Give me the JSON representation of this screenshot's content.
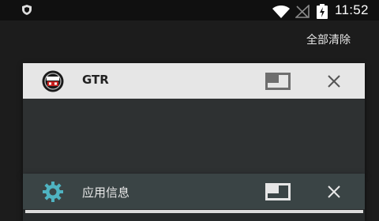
{
  "status_bar": {
    "time": "11:52",
    "icons": [
      "shield-icon",
      "wifi-icon",
      "no-signal-icon",
      "battery-charging-icon"
    ]
  },
  "recents": {
    "clear_all_label": "全部清除",
    "cards": [
      {
        "title": "GTR",
        "icon": "gtr-app-icon",
        "multiwindow_icon": "split-screen-icon",
        "close_icon": "close-icon"
      },
      {
        "title": "应用信息",
        "icon": "gear-icon",
        "multiwindow_icon": "split-screen-icon",
        "close_icon": "close-icon"
      }
    ]
  },
  "colors": {
    "status_bar_bg": "#101010",
    "background": "#1c1c1c",
    "card_header_light": "#e6e6e6",
    "card_header_dark": "#3a4445",
    "accent_teal": "#4fb3c1"
  }
}
